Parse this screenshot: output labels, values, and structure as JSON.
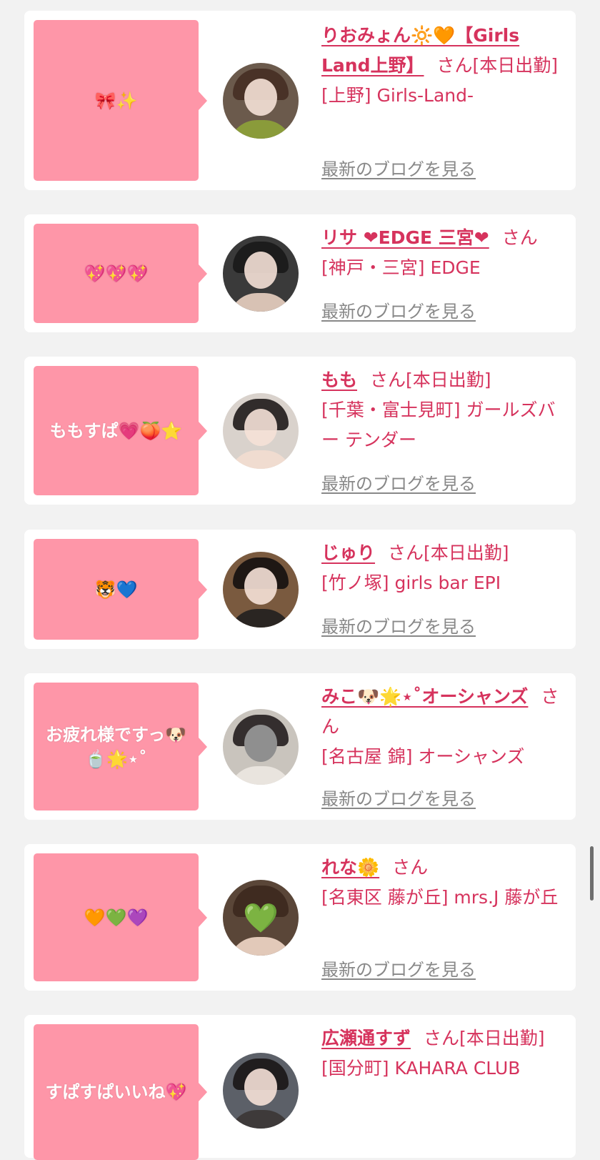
{
  "colors": {
    "page_bg": "#f2f2f2",
    "card_bg": "#ffffff",
    "bubble_bg": "#fe96a8",
    "accent_text": "#d6335d",
    "link_gray": "#888888"
  },
  "blog_link_label": "最新のブログを見る",
  "san_label": "さん",
  "entries": [
    {
      "message": "🎀✨",
      "name": "りおみょん🔆🧡【Girls Land上野】",
      "suffix": "さん[本日出勤]",
      "shop": "[上野] Girls-Land-",
      "avatar_icon": "portrait-photo"
    },
    {
      "message": "💖💖💖",
      "name": "リサ ❤EDGE 三宮❤",
      "suffix": "さん",
      "shop": "[神戸・三宮] EDGE",
      "avatar_icon": "portrait-photo"
    },
    {
      "message": "ももすぱ💗🍑⭐",
      "name": "もも",
      "suffix": "さん[本日出勤]",
      "shop": "[千葉・富士見町] ガールズバー テンダー",
      "avatar_icon": "portrait-photo"
    },
    {
      "message": "🐯💙",
      "name": "じゅり",
      "suffix": "さん[本日出勤]",
      "shop": "[竹ノ塚] girls bar EPI",
      "avatar_icon": "portrait-photo"
    },
    {
      "message": "お疲れ様ですっ🐶🍵🌟⋆˚",
      "name": "みこ🐶🌟⋆˚オーシャンズ",
      "suffix": "さん",
      "shop": "[名古屋 錦] オーシャンズ",
      "avatar_icon": "portrait-photo"
    },
    {
      "message": "🧡💚💜",
      "name": "れな🌼",
      "suffix": "さん",
      "shop": "[名東区 藤が丘] mrs.J 藤が丘",
      "avatar_icon": "green-heart-sticker"
    },
    {
      "message": "すぱすぱいいね💖",
      "name": "広瀬通すず",
      "suffix": "さん[本日出勤]",
      "shop": "[国分町] KAHARA CLUB",
      "avatar_icon": "portrait-photo"
    }
  ]
}
